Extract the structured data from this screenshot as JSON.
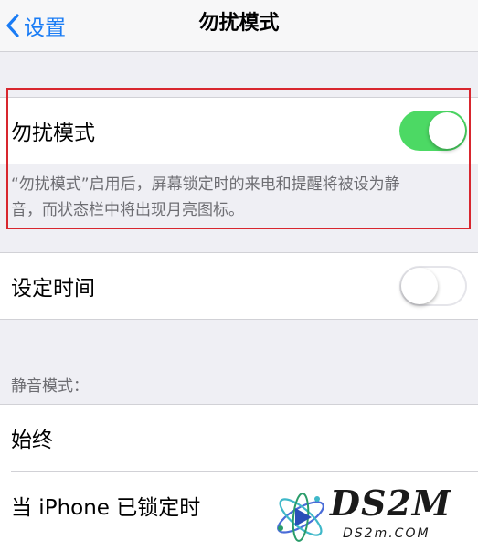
{
  "navbar": {
    "back_label": "设置",
    "title": "勿扰模式"
  },
  "dnd": {
    "label": "勿扰模式",
    "toggle_on": true,
    "description_line1": "“勿扰模式”启用后，屏幕锁定时的来电和提醒将被设为静",
    "description_line2": "音，而状态栏中将出现月亮图标。"
  },
  "schedule": {
    "label": "设定时间",
    "toggle_on": false
  },
  "silence": {
    "header": "静音模式：",
    "options": [
      "始终",
      "当 iPhone 已锁定时"
    ]
  },
  "watermark": {
    "logo_text": "DS2M",
    "url_text": "DS2m.COM"
  },
  "colors": {
    "accent": "#1a7cf5",
    "switch_on": "#4cd964",
    "highlight": "#d8262e"
  }
}
